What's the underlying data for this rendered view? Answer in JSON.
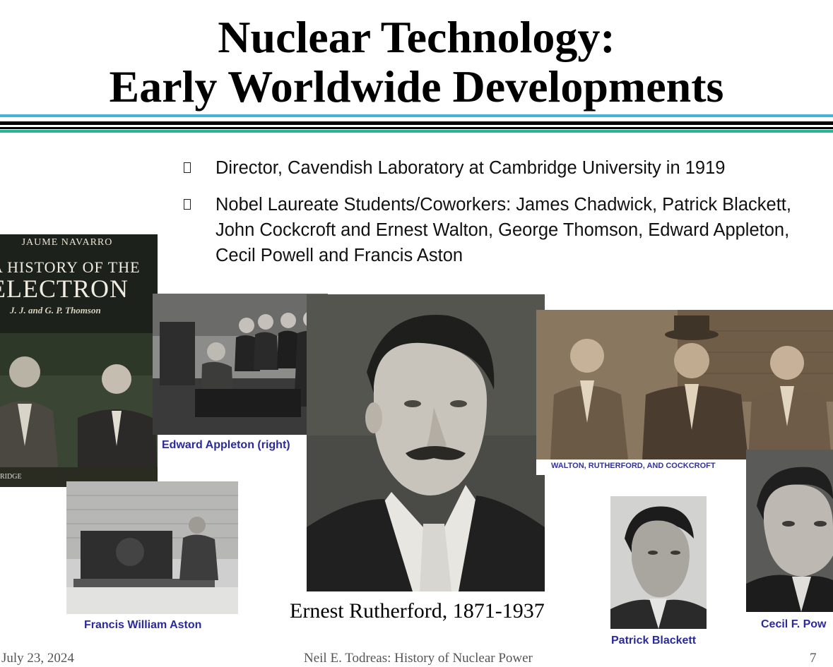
{
  "slide": {
    "title_line1": "Nuclear Technology:",
    "title_line2": "Early Worldwide Developments"
  },
  "bullets": [
    "Director, Cavendish Laboratory at Cambridge University in 1919",
    "Nobel Laureate Students/Coworkers:  James Chadwick, Patrick Blackett, John Cockcroft and Ernest Walton, George Thomson, Edward Appleton, Cecil Powell and Francis Aston"
  ],
  "book": {
    "author": "JAUME NAVARRO",
    "title_line1": "A HISTORY OF THE",
    "title_line2": "ELECTRON",
    "subtitle": "J. J. and G. P. Thomson",
    "publisher": "RIDGE"
  },
  "captions": {
    "appleton": "Edward Appleton (right)",
    "aston": "Francis William Aston",
    "rutherford": "Ernest Rutherford, 1871-1937",
    "walton_group": "WALTON, RUTHERFORD, AND COCKCROFT",
    "blackett": "Patrick Blackett",
    "powell": "Cecil F. Pow"
  },
  "footer": {
    "date": "July 23, 2024",
    "center": "Neil E. Todreas: History of Nuclear Power",
    "page": "7"
  },
  "colors": {
    "rule_cyan": "#3fb3dc",
    "rule_teal": "#27b39a",
    "caption_blue": "#2a2a9e"
  }
}
